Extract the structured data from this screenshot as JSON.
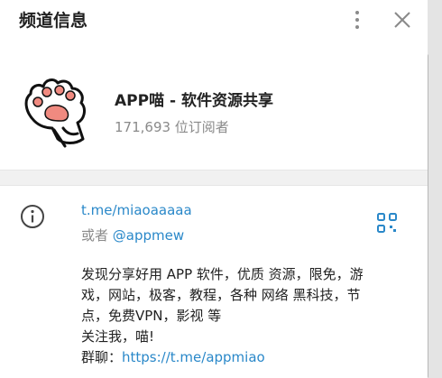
{
  "header": {
    "title": "频道信息"
  },
  "channel": {
    "name": "APP喵 - 软件资源共享",
    "subscribers": "171,693 位订阅者",
    "link": "t.me/miaoaaaaa",
    "alt_prefix": "或者 ",
    "alt_username": "@appmew"
  },
  "description": {
    "line1": "发现分享好用 APP 软件，优质 资源，限免，游",
    "line2": "戏，网站，极客，教程，各种 网络 黑科技，节",
    "line3": "点，免费VPN，影视 等",
    "line4": "关注我，喵!",
    "group_prefix": "群聊：",
    "group_link": "https://t.me/appmiao"
  },
  "icons": {
    "more": "more-vertical-icon",
    "close": "close-icon",
    "info": "info-icon",
    "qr": "qr-code-icon",
    "avatar": "cat-paw-logo"
  },
  "colors": {
    "accent": "#2a88c9",
    "muted": "#8a8a8a",
    "paw_pink": "#f08a80"
  }
}
